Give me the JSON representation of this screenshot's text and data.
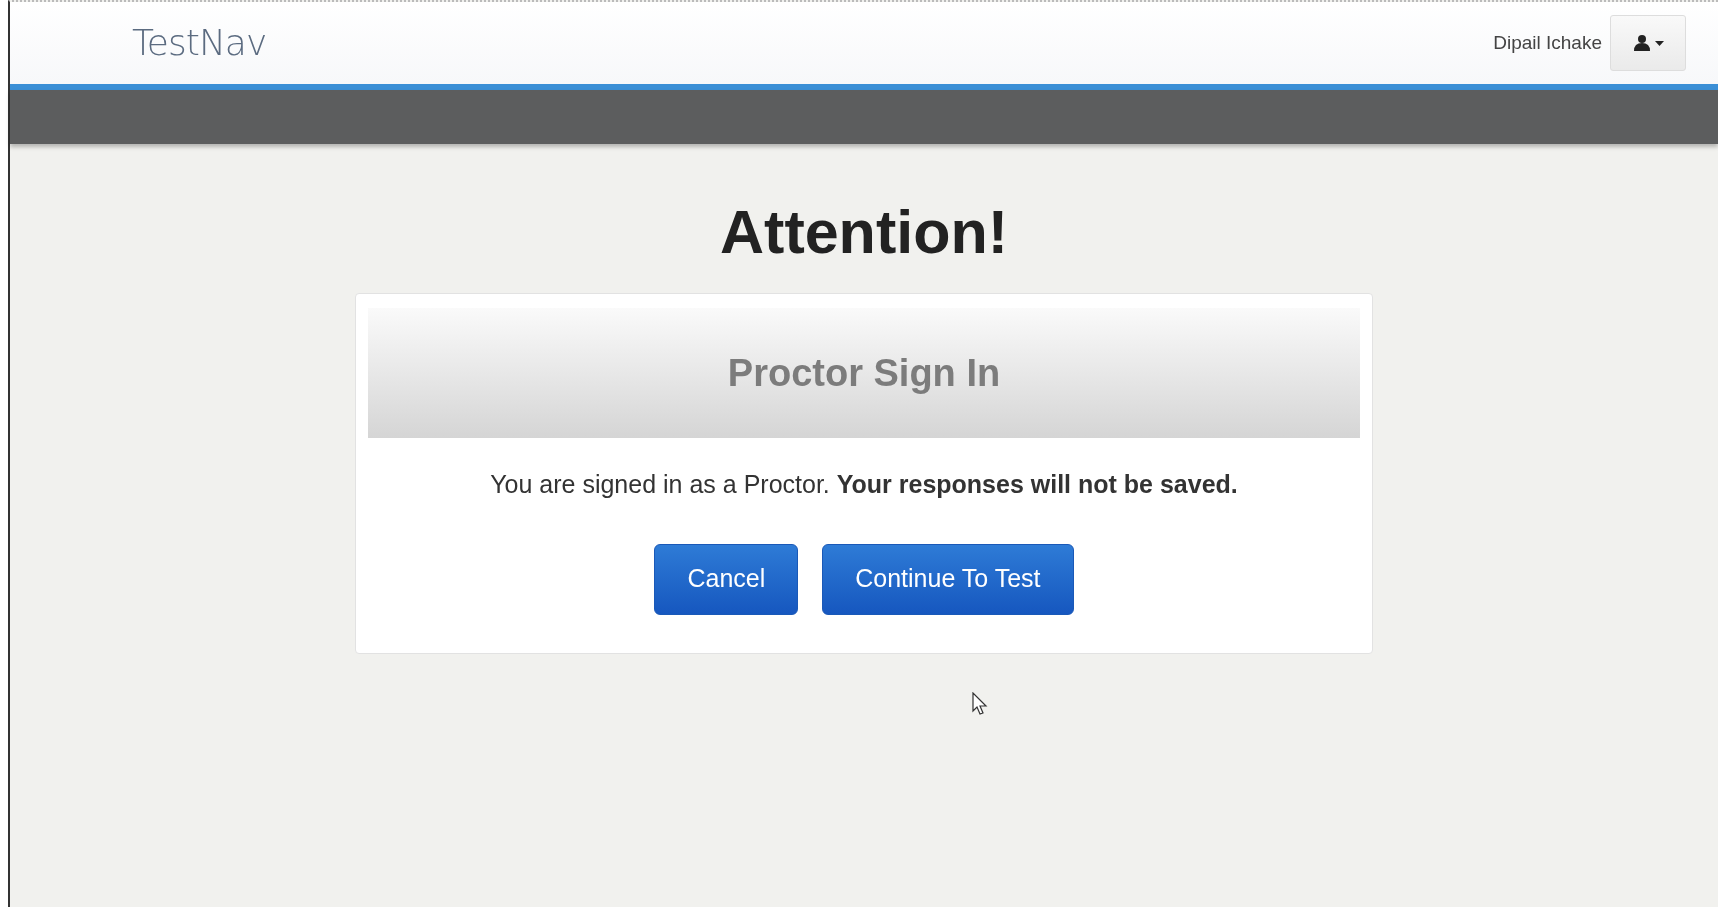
{
  "header": {
    "brand": "TestNav",
    "user_name": "Dipail Ichake"
  },
  "heading": "Attention!",
  "dialog": {
    "title": "Proctor Sign In",
    "message": "You are signed in as a Proctor. **Your responses will not be saved.**",
    "buttons": [
      {
        "label": "Cancel"
      },
      {
        "label": "Continue To Test"
      }
    ]
  }
}
